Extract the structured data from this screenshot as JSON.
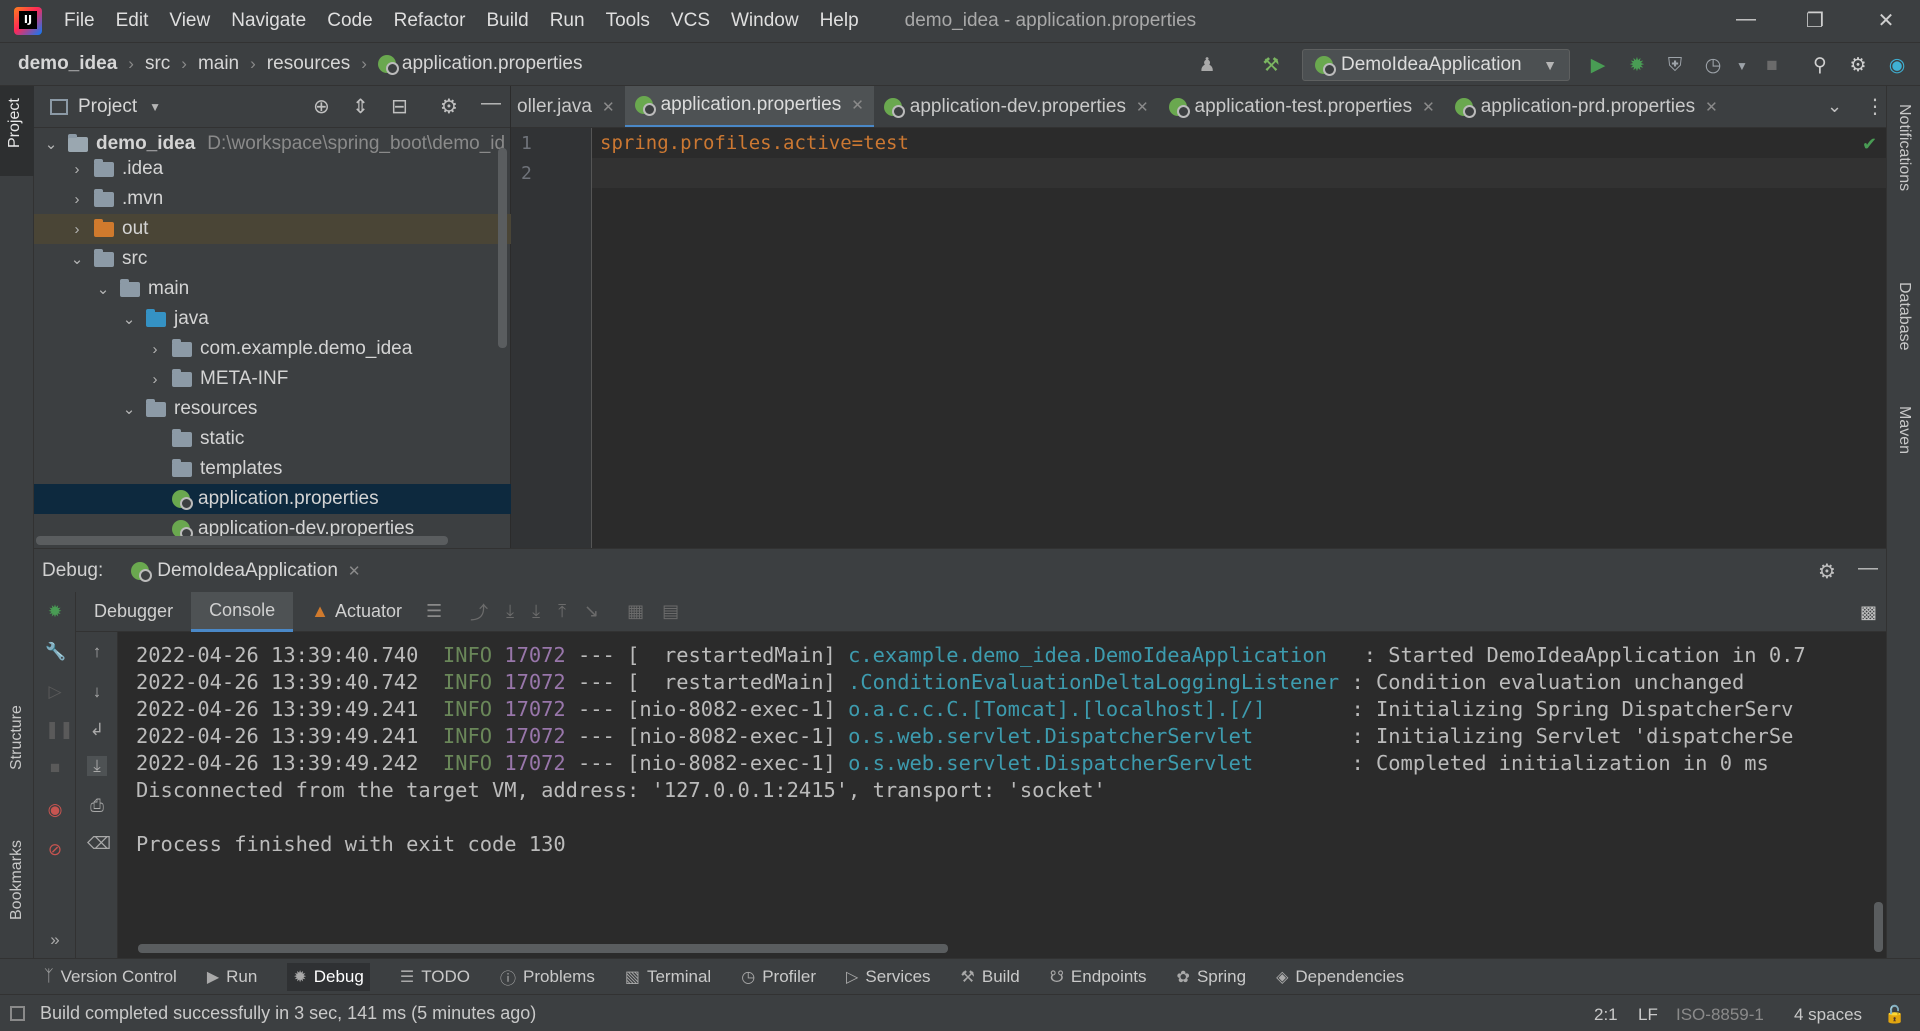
{
  "menu": {
    "items": [
      "File",
      "Edit",
      "View",
      "Navigate",
      "Code",
      "Refactor",
      "Build",
      "Run",
      "Tools",
      "VCS",
      "Window",
      "Help"
    ],
    "window_title": "demo_idea - application.properties"
  },
  "breadcrumb": [
    "demo_idea",
    "src",
    "main",
    "resources",
    "application.properties"
  ],
  "run_config": "DemoIdeaApplication",
  "project": {
    "header": "Project",
    "rows": [
      {
        "label": "demo_idea",
        "path": "D:\\workspace\\spring_boot\\demo_id"
      },
      {
        "label": ".idea"
      },
      {
        "label": ".mvn"
      },
      {
        "label": "out"
      },
      {
        "label": "src"
      },
      {
        "label": "main"
      },
      {
        "label": "java"
      },
      {
        "label": "com.example.demo_idea"
      },
      {
        "label": "META-INF"
      },
      {
        "label": "resources"
      },
      {
        "label": "static"
      },
      {
        "label": "templates"
      },
      {
        "label": "application.properties"
      },
      {
        "label": "application-dev.properties"
      }
    ]
  },
  "editor": {
    "tabs": [
      {
        "label": "oller.java"
      },
      {
        "label": "application.properties"
      },
      {
        "label": "application-dev.properties"
      },
      {
        "label": "application-test.properties"
      },
      {
        "label": "application-prd.properties"
      }
    ],
    "line_numbers": [
      "1",
      "2"
    ],
    "code": {
      "key": "spring.profiles.active",
      "eq": "=",
      "value": "test"
    }
  },
  "debug": {
    "label": "Debug:",
    "session": "DemoIdeaApplication",
    "subtabs": [
      "Debugger",
      "Console",
      "Actuator"
    ],
    "log": [
      {
        "ts": "2022-04-26 13:39:40.740",
        "level": "INFO",
        "pid": "17072",
        "sep": "---",
        "thread": "[  restartedMain]",
        "logger": "c.example.demo_idea.DemoIdeaApplication  ",
        "msg": ": Started DemoIdeaApplication in 0.7"
      },
      {
        "ts": "2022-04-26 13:39:40.742",
        "level": "INFO",
        "pid": "17072",
        "sep": "---",
        "thread": "[  restartedMain]",
        "logger": ".ConditionEvaluationDeltaLoggingListener",
        "msg": ": Condition evaluation unchanged"
      },
      {
        "ts": "2022-04-26 13:39:49.241",
        "level": "INFO",
        "pid": "17072",
        "sep": "---",
        "thread": "[nio-8082-exec-1]",
        "logger": "o.a.c.c.C.[Tomcat].[localhost].[/]      ",
        "msg": ": Initializing Spring DispatcherServ"
      },
      {
        "ts": "2022-04-26 13:39:49.241",
        "level": "INFO",
        "pid": "17072",
        "sep": "---",
        "thread": "[nio-8082-exec-1]",
        "logger": "o.s.web.servlet.DispatcherServlet       ",
        "msg": ": Initializing Servlet 'dispatcherSe"
      },
      {
        "ts": "2022-04-26 13:39:49.242",
        "level": "INFO",
        "pid": "17072",
        "sep": "---",
        "thread": "[nio-8082-exec-1]",
        "logger": "o.s.web.servlet.DispatcherServlet       ",
        "msg": ": Completed initialization in 0 ms"
      }
    ],
    "disconnected": "Disconnected from the target VM, address: '127.0.0.1:2415', transport: 'socket'",
    "finished": "Process finished with exit code 130"
  },
  "tool_windows": [
    "Version Control",
    "Run",
    "Debug",
    "TODO",
    "Problems",
    "Terminal",
    "Profiler",
    "Services",
    "Build",
    "Endpoints",
    "Spring",
    "Dependencies"
  ],
  "left_strip": [
    "Project",
    "Structure",
    "Bookmarks"
  ],
  "right_strip": [
    "Notifications",
    "Database",
    "Maven"
  ],
  "status": {
    "message": "Build completed successfully in 3 sec, 141 ms (5 minutes ago)",
    "position": "2:1",
    "line_sep": "LF",
    "encoding": "ISO-8859-1",
    "indent": "4 spaces"
  },
  "colors": {
    "accent": "#4a88c7",
    "run_green": "#499c54",
    "key_orange": "#cc7832",
    "value_green": "#6a8759"
  }
}
